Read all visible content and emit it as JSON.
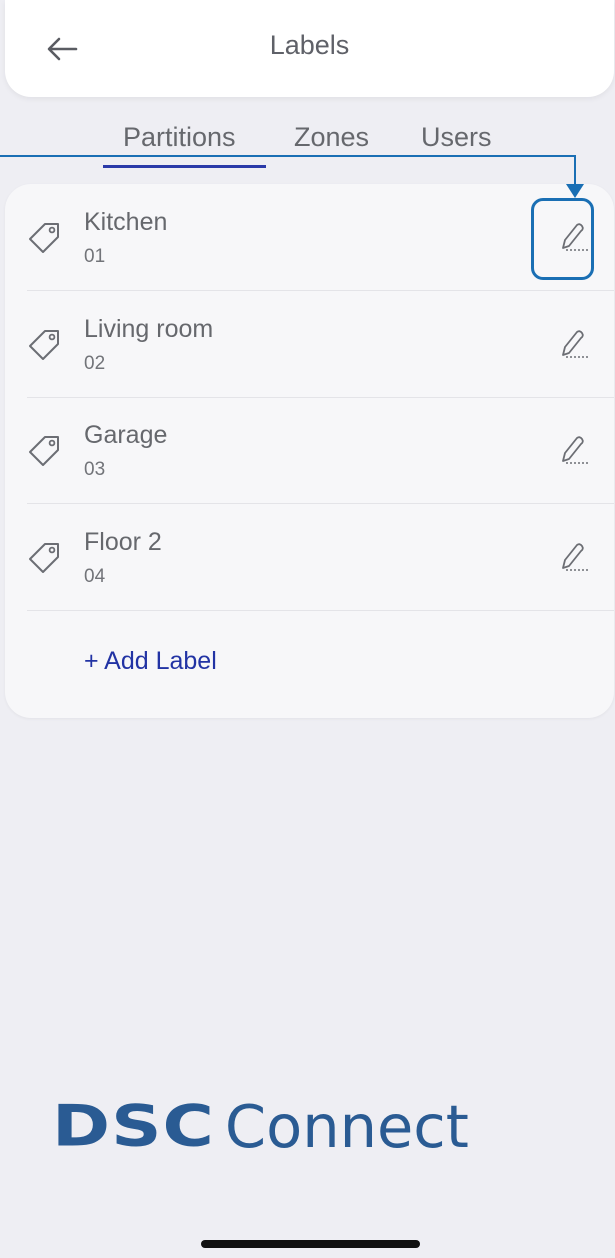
{
  "header": {
    "back_icon": "arrow-left-icon",
    "title": "Labels"
  },
  "tabs": [
    {
      "label": "Partitions",
      "active": true
    },
    {
      "label": "Zones",
      "active": false
    },
    {
      "label": "Users",
      "active": false
    }
  ],
  "list": {
    "items": [
      {
        "label": "Kitchen",
        "number": "01"
      },
      {
        "label": "Living room",
        "number": "02"
      },
      {
        "label": "Garage",
        "number": "03"
      },
      {
        "label": "Floor 2",
        "number": "04"
      }
    ],
    "add_label": "+ Add Label",
    "item_icon": "tag-icon",
    "edit_icon": "pencil-icon"
  },
  "logo": {
    "brand": "DSC",
    "product": "Connect"
  },
  "colors": {
    "accent": "#2233a4",
    "callout": "#1a6fb4",
    "logo": "#2a5b93",
    "background": "#eeeef3"
  }
}
